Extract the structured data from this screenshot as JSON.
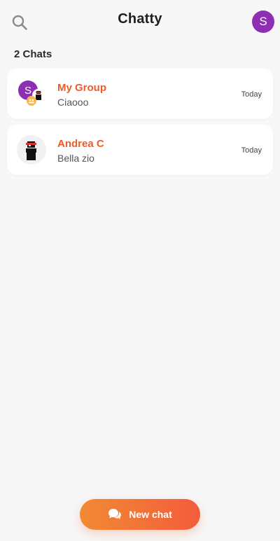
{
  "header": {
    "title": "Chatty",
    "avatar_initial": "S",
    "search_icon": "search-icon"
  },
  "chat_count_label": "2 Chats",
  "chats": [
    {
      "name": "My Group",
      "last_message": "Ciaooo",
      "time": "Today",
      "avatar_type": "group",
      "avatar_initial": "S"
    },
    {
      "name": "Andrea C",
      "last_message": "Bella zio",
      "time": "Today",
      "avatar_type": "person"
    }
  ],
  "fab": {
    "label": "New chat",
    "icon": "chat-bubbles-icon"
  },
  "colors": {
    "accent": "#f05a28",
    "avatar_purple": "#8e2fb3",
    "fab_start": "#f28a34",
    "fab_end": "#f35c3c",
    "background": "#f7f7f7"
  }
}
